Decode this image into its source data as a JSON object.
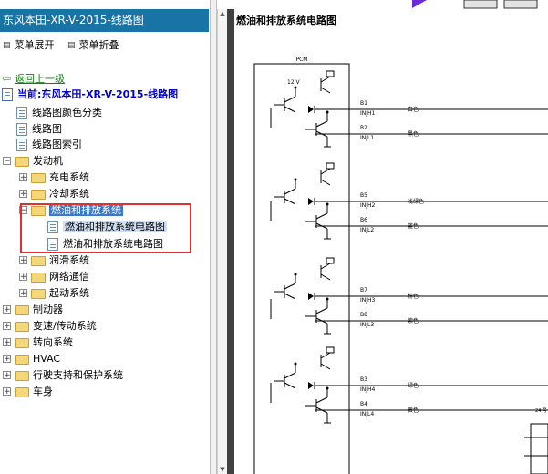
{
  "left_panel": {
    "title": "东风本田-XR-V-2015-线路图",
    "expand_label": "菜单展开",
    "collapse_label": "菜单折叠",
    "back_label": "返回上一级",
    "current_label": "当前:东风本田-XR-V-2015-线路图",
    "tree": {
      "color_category": "线路图颜色分类",
      "wiring": "线路图",
      "wiring_index": "线路图索引",
      "engine": "发动机",
      "charging": "充电系统",
      "cooling": "冷却系统",
      "fuel_exhaust": "燃油和排放系统",
      "fuel_diagram_1": "燃油和排放系统电路图",
      "fuel_diagram_2": "燃油和排放系统电路图",
      "lubrication": "润滑系统",
      "network": "网络通信",
      "starting": "起动系统",
      "brake": "制动器",
      "transmission": "变速/传动系统",
      "steering": "转向系统",
      "hvac": "HVAC",
      "safety": "行驶支持和保护系统",
      "body": "车身"
    }
  },
  "right_panel": {
    "title": "燃油和排放系统电路图",
    "diagram": {
      "pcm_label": "PCM",
      "voltage_label": "12 V",
      "pins": [
        {
          "pin": "B1",
          "sig": "INJH1",
          "color": "白色"
        },
        {
          "pin": "B2",
          "sig": "INJL1",
          "color": "黑色"
        },
        {
          "pin": "B5",
          "sig": "INJH2",
          "color": "浅绿色"
        },
        {
          "pin": "B6",
          "sig": "INJL2",
          "color": "蓝色"
        },
        {
          "pin": "B7",
          "sig": "INJH3",
          "color": "粉色"
        },
        {
          "pin": "B8",
          "sig": "INJL3",
          "color": "紫色"
        },
        {
          "pin": "B3",
          "sig": "INJH4",
          "color": "绿色"
        },
        {
          "pin": "B4",
          "sig": "INJL4",
          "color": "黄色"
        }
      ],
      "corner_label": "24 号"
    }
  }
}
